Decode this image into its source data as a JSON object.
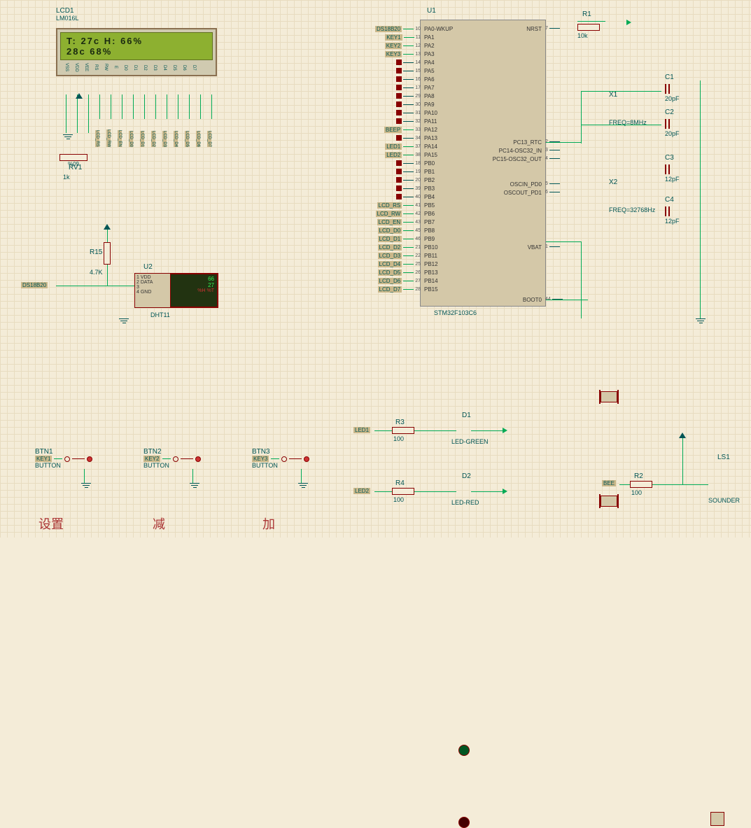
{
  "lcd": {
    "ref": "LCD1",
    "part": "LM016L",
    "line1": "T: 27c  H: 66%",
    "line2": "   28c     68%",
    "pins": [
      "VSS",
      "VDD",
      "VEE",
      "RS",
      "RW",
      "E",
      "D0",
      "D1",
      "D2",
      "D3",
      "D4",
      "D5",
      "D6",
      "D7"
    ],
    "nets": [
      "",
      "",
      "",
      "LCD_RS",
      "LCD_RW",
      "LCD_EN",
      "LCD_D0",
      "LCD_D1",
      "LCD_D2",
      "LCD_D3",
      "LCD_D4",
      "LCD_D5",
      "LCD_D6",
      "LCD_D7"
    ]
  },
  "pot": {
    "ref": "RV1",
    "value": "1k"
  },
  "mcu": {
    "ref": "U1",
    "part": "STM32F103C6",
    "left_pins": [
      {
        "num": "10",
        "name": "PA0-WKUP",
        "net": "DS18B20"
      },
      {
        "num": "11",
        "name": "PA1",
        "net": "KEY1"
      },
      {
        "num": "12",
        "name": "PA2",
        "net": "KEY2"
      },
      {
        "num": "13",
        "name": "PA3",
        "net": "KEY3"
      },
      {
        "num": "14",
        "name": "PA4",
        "net": ""
      },
      {
        "num": "15",
        "name": "PA5",
        "net": ""
      },
      {
        "num": "16",
        "name": "PA6",
        "net": ""
      },
      {
        "num": "17",
        "name": "PA7",
        "net": ""
      },
      {
        "num": "29",
        "name": "PA8",
        "net": ""
      },
      {
        "num": "30",
        "name": "PA9",
        "net": ""
      },
      {
        "num": "31",
        "name": "PA10",
        "net": ""
      },
      {
        "num": "32",
        "name": "PA11",
        "net": ""
      },
      {
        "num": "33",
        "name": "PA12",
        "net": "BEEP"
      },
      {
        "num": "34",
        "name": "PA13",
        "net": ""
      },
      {
        "num": "37",
        "name": "PA14",
        "net": "LED1"
      },
      {
        "num": "38",
        "name": "PA15",
        "net": "LED2"
      },
      {
        "num": "18",
        "name": "PB0",
        "net": ""
      },
      {
        "num": "19",
        "name": "PB1",
        "net": ""
      },
      {
        "num": "20",
        "name": "PB2",
        "net": ""
      },
      {
        "num": "39",
        "name": "PB3",
        "net": ""
      },
      {
        "num": "40",
        "name": "PB4",
        "net": ""
      },
      {
        "num": "41",
        "name": "PB5",
        "net": "LCD_RS"
      },
      {
        "num": "42",
        "name": "PB6",
        "net": "LCD_RW"
      },
      {
        "num": "43",
        "name": "PB7",
        "net": "LCD_EN"
      },
      {
        "num": "45",
        "name": "PB8",
        "net": "LCD_D0"
      },
      {
        "num": "46",
        "name": "PB9",
        "net": "LCD_D1"
      },
      {
        "num": "21",
        "name": "PB10",
        "net": "LCD_D2"
      },
      {
        "num": "22",
        "name": "PB11",
        "net": "LCD_D3"
      },
      {
        "num": "25",
        "name": "PB12",
        "net": "LCD_D4"
      },
      {
        "num": "26",
        "name": "PB13",
        "net": "LCD_D5"
      },
      {
        "num": "27",
        "name": "PB14",
        "net": "LCD_D6"
      },
      {
        "num": "28",
        "name": "PB15",
        "net": "LCD_D7"
      }
    ],
    "right_pins": [
      {
        "num": "7",
        "name": "NRST"
      },
      {
        "num": "2",
        "name": "PC13_RTC"
      },
      {
        "num": "3",
        "name": "PC14-OSC32_IN"
      },
      {
        "num": "4",
        "name": "PC15-OSC32_OUT"
      },
      {
        "num": "5",
        "name": "OSCIN_PD0"
      },
      {
        "num": "6",
        "name": "OSCOUT_PD1"
      },
      {
        "num": "1",
        "name": "VBAT"
      },
      {
        "num": "44",
        "name": "BOOT0"
      }
    ]
  },
  "r1": {
    "ref": "R1",
    "value": "10k"
  },
  "r2": {
    "ref": "R2",
    "value": "100"
  },
  "r3": {
    "ref": "R3",
    "value": "100"
  },
  "r4": {
    "ref": "R4",
    "value": "100"
  },
  "r15": {
    "ref": "R15",
    "value": "4.7K"
  },
  "c1": {
    "ref": "C1",
    "value": "20pF"
  },
  "c2": {
    "ref": "C2",
    "value": "20pF"
  },
  "c3": {
    "ref": "C3",
    "value": "12pF"
  },
  "c4": {
    "ref": "C4",
    "value": "12pF"
  },
  "x1": {
    "ref": "X1",
    "freq": "FREQ=8MHz"
  },
  "x2": {
    "ref": "X2",
    "freq": "FREQ=32768Hz"
  },
  "u2": {
    "ref": "U2",
    "part": "DHT11",
    "pins": [
      "VDD",
      "DATA",
      "",
      "GND"
    ],
    "val1": "66",
    "val2": "27",
    "legend": "%H  %T"
  },
  "ds18b20_net": "DS18B20",
  "btn1": {
    "ref": "BTN1",
    "part": "BUTTON",
    "net": "KEY1",
    "label": "设置"
  },
  "btn2": {
    "ref": "BTN2",
    "part": "BUTTON",
    "net": "KEY2",
    "label": "减"
  },
  "btn3": {
    "ref": "BTN3",
    "part": "BUTTON",
    "net": "KEY3",
    "label": "加"
  },
  "d1": {
    "ref": "D1",
    "part": "LED-GREEN",
    "net": "LED1"
  },
  "d2": {
    "ref": "D2",
    "part": "LED-RED",
    "net": "LED2"
  },
  "ls1": {
    "ref": "LS1",
    "part": "SOUNDER",
    "net": "BEE"
  }
}
